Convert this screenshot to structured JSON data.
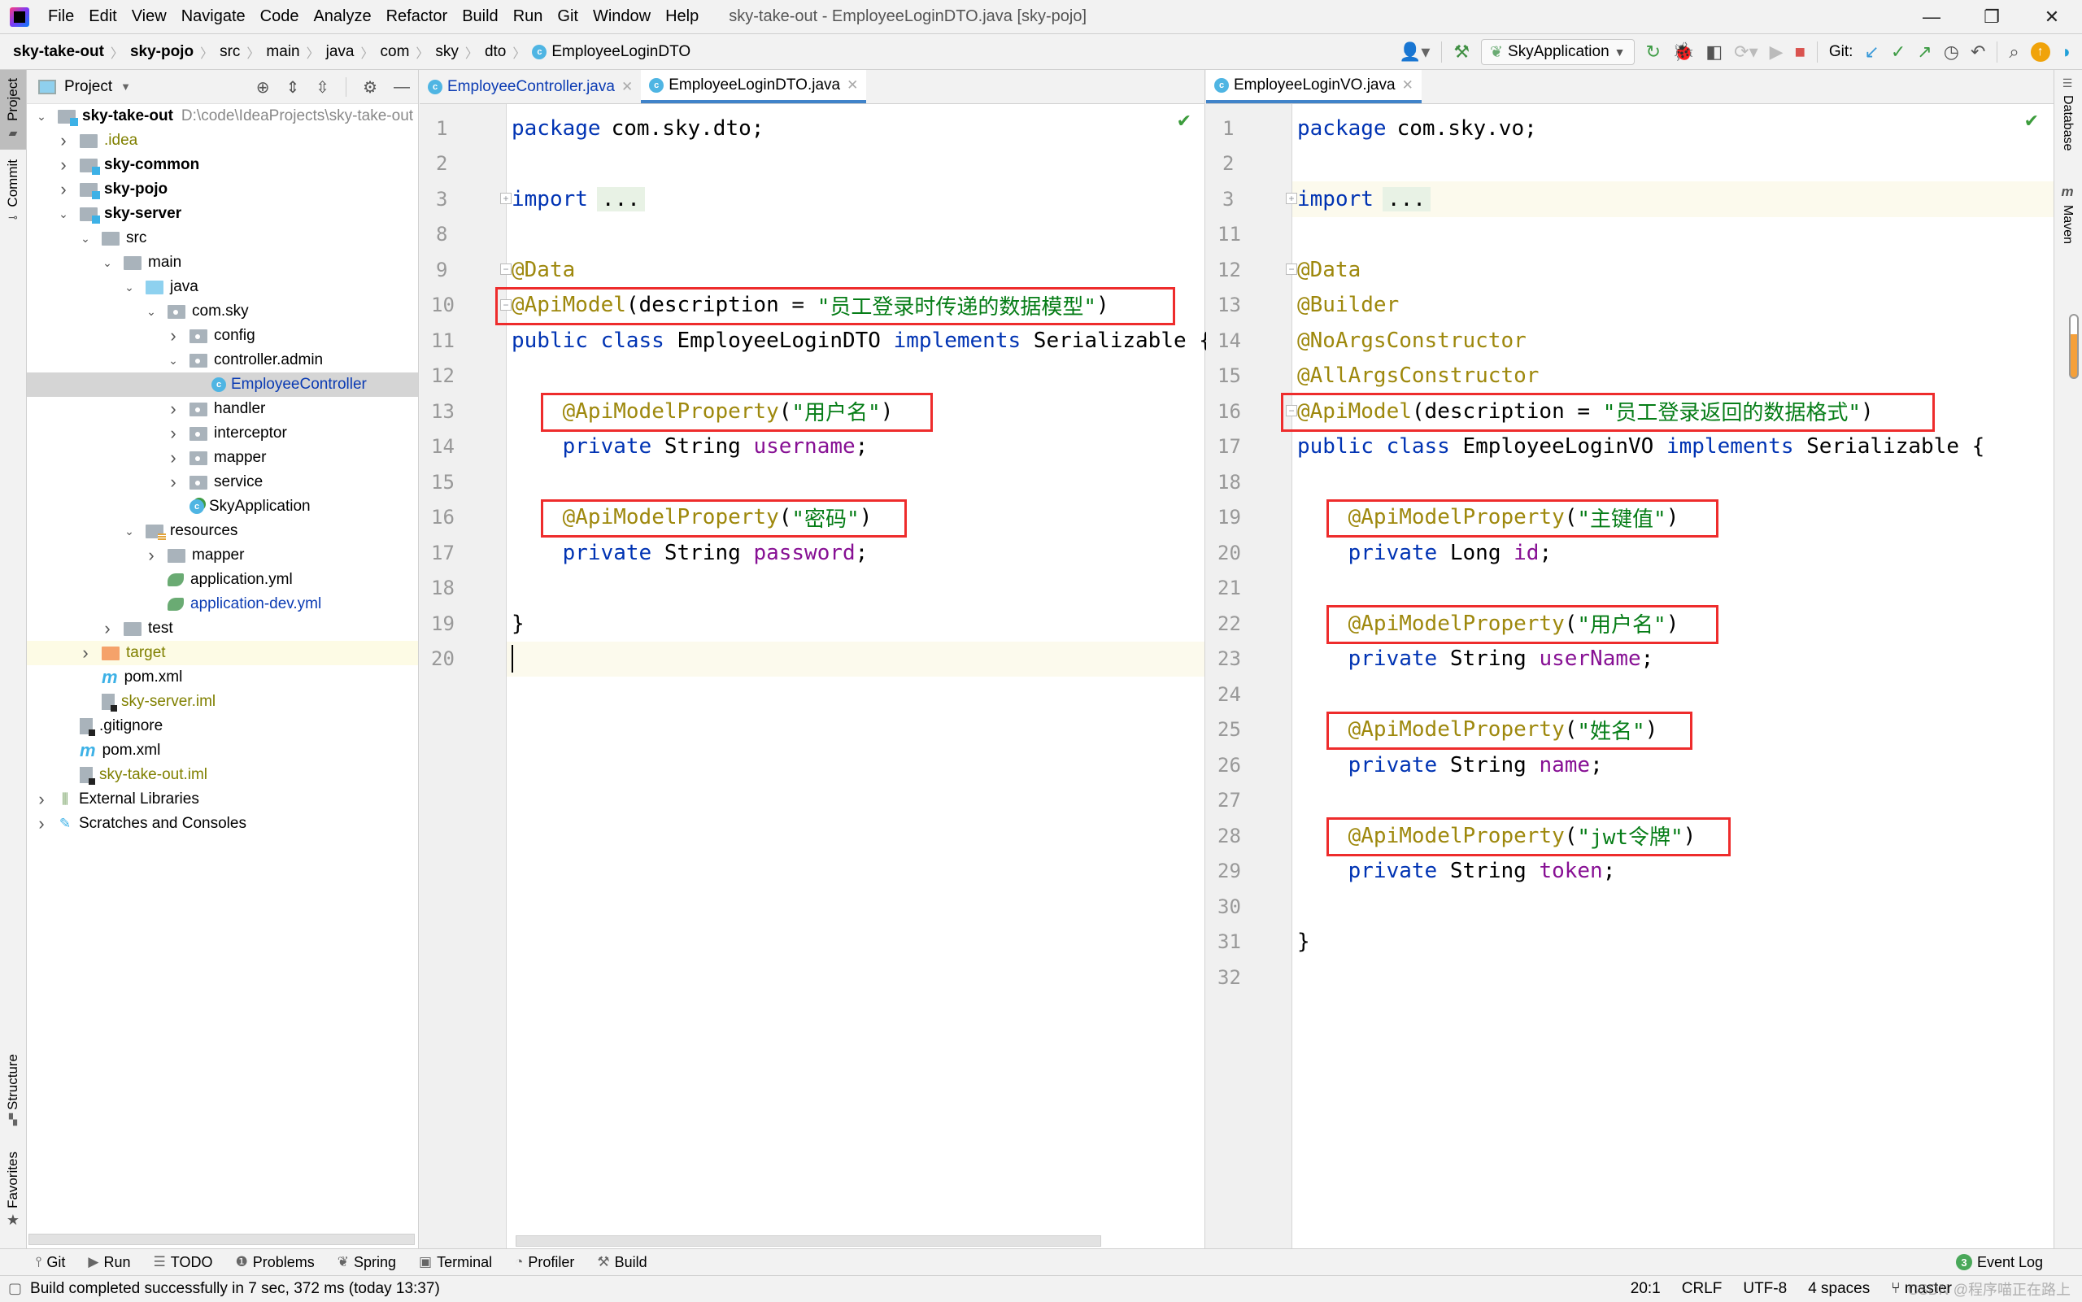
{
  "window": {
    "title": "sky-take-out - EmployeeLoginDTO.java [sky-pojo]",
    "menu": [
      "File",
      "Edit",
      "View",
      "Navigate",
      "Code",
      "Analyze",
      "Refactor",
      "Build",
      "Run",
      "Git",
      "Window",
      "Help"
    ],
    "controls": {
      "minimize": "—",
      "restore": "❐",
      "close": "✕"
    }
  },
  "breadcrumb": [
    "sky-take-out",
    "sky-pojo",
    "src",
    "main",
    "java",
    "com",
    "sky",
    "dto",
    "EmployeeLoginDTO"
  ],
  "toolbar": {
    "run_config": "SkyApplication",
    "git_label": "Git:"
  },
  "left_strip": {
    "project": "Project",
    "commit": "Commit",
    "structure": "Structure",
    "favorites": "Favorites"
  },
  "right_strip": {
    "database": "Database",
    "maven": "Maven"
  },
  "project_panel": {
    "title": "Project",
    "tree": [
      {
        "label": "sky-take-out",
        "path": "D:\\code\\IdeaProjects\\sky-take-out",
        "depth": 0,
        "chevron": "down",
        "icon": "module-folder",
        "style": "bold"
      },
      {
        "label": ".idea",
        "depth": 1,
        "chevron": "right",
        "icon": "folder",
        "style": "olive"
      },
      {
        "label": "sky-common",
        "depth": 1,
        "chevron": "right",
        "icon": "module-folder",
        "style": "bold"
      },
      {
        "label": "sky-pojo",
        "depth": 1,
        "chevron": "right",
        "icon": "module-folder",
        "style": "bold"
      },
      {
        "label": "sky-server",
        "depth": 1,
        "chevron": "down",
        "icon": "module-folder",
        "style": "bold"
      },
      {
        "label": "src",
        "depth": 2,
        "chevron": "down",
        "icon": "folder",
        "style": ""
      },
      {
        "label": "main",
        "depth": 3,
        "chevron": "down",
        "icon": "folder",
        "style": ""
      },
      {
        "label": "java",
        "depth": 4,
        "chevron": "down",
        "icon": "source-folder",
        "style": ""
      },
      {
        "label": "com.sky",
        "depth": 5,
        "chevron": "down",
        "icon": "package",
        "style": ""
      },
      {
        "label": "config",
        "depth": 6,
        "chevron": "right",
        "icon": "package",
        "style": ""
      },
      {
        "label": "controller.admin",
        "depth": 6,
        "chevron": "down",
        "icon": "package",
        "style": ""
      },
      {
        "label": "EmployeeController",
        "depth": 7,
        "chevron": "",
        "icon": "class",
        "style": "blue",
        "selected": true
      },
      {
        "label": "handler",
        "depth": 6,
        "chevron": "right",
        "icon": "package",
        "style": ""
      },
      {
        "label": "interceptor",
        "depth": 6,
        "chevron": "right",
        "icon": "package",
        "style": ""
      },
      {
        "label": "mapper",
        "depth": 6,
        "chevron": "right",
        "icon": "package",
        "style": ""
      },
      {
        "label": "service",
        "depth": 6,
        "chevron": "right",
        "icon": "package",
        "style": ""
      },
      {
        "label": "SkyApplication",
        "depth": 6,
        "chevron": "",
        "icon": "spring-boot-class",
        "style": ""
      },
      {
        "label": "resources",
        "depth": 4,
        "chevron": "down",
        "icon": "resources-folder",
        "style": ""
      },
      {
        "label": "mapper",
        "depth": 5,
        "chevron": "right",
        "icon": "folder",
        "style": ""
      },
      {
        "label": "application.yml",
        "depth": 5,
        "chevron": "",
        "icon": "spring-config",
        "style": ""
      },
      {
        "label": "application-dev.yml",
        "depth": 5,
        "chevron": "",
        "icon": "spring-config",
        "style": "blue"
      },
      {
        "label": "test",
        "depth": 3,
        "chevron": "right",
        "icon": "folder",
        "style": ""
      },
      {
        "label": "target",
        "depth": 2,
        "chevron": "right",
        "icon": "excluded-folder",
        "style": "olive",
        "excluded": true
      },
      {
        "label": "pom.xml",
        "depth": 2,
        "chevron": "",
        "icon": "maven",
        "style": ""
      },
      {
        "label": "sky-server.iml",
        "depth": 2,
        "chevron": "",
        "icon": "iml",
        "style": "olive"
      },
      {
        "label": ".gitignore",
        "depth": 1,
        "chevron": "",
        "icon": "ignore-file",
        "style": ""
      },
      {
        "label": "pom.xml",
        "depth": 1,
        "chevron": "",
        "icon": "maven",
        "style": ""
      },
      {
        "label": "sky-take-out.iml",
        "depth": 1,
        "chevron": "",
        "icon": "iml",
        "style": "olive"
      },
      {
        "label": "External Libraries",
        "depth": 0,
        "chevron": "right",
        "icon": "libraries",
        "style": ""
      },
      {
        "label": "Scratches and Consoles",
        "depth": 0,
        "chevron": "right",
        "icon": "scratches",
        "style": ""
      }
    ]
  },
  "left_editor": {
    "tabs": [
      {
        "label": "EmployeeController.java",
        "active": false
      },
      {
        "label": "EmployeeLoginDTO.java",
        "active": true
      }
    ],
    "lines": [
      {
        "n": "1",
        "tokens": [
          [
            "kw",
            "package"
          ],
          [
            "",
            "com.sky.dto;"
          ]
        ]
      },
      {
        "n": "2",
        "tokens": []
      },
      {
        "n": "3",
        "tokens": [
          [
            "kw",
            "import"
          ],
          [
            "",
            ""
          ],
          [
            "ellipsis",
            "..."
          ]
        ],
        "fold": "+"
      },
      {
        "n": "8",
        "tokens": []
      },
      {
        "n": "9",
        "tokens": [
          [
            "ann",
            "@Data"
          ]
        ],
        "fold": "-"
      },
      {
        "n": "10",
        "tokens": [
          [
            "ann",
            "@ApiModel"
          ],
          [
            "",
            "(description = "
          ],
          [
            "str",
            "\"员工登录时传递的数据模型\""
          ],
          [
            "",
            ")"
          ]
        ],
        "fold": "-",
        "boxed": true
      },
      {
        "n": "11",
        "tokens": [
          [
            "kw",
            "public class "
          ],
          [
            "",
            "EmployeeLoginDTO "
          ],
          [
            "kw",
            "implements "
          ],
          [
            "",
            "Serializable {"
          ]
        ]
      },
      {
        "n": "12",
        "tokens": []
      },
      {
        "n": "13",
        "tokens": [
          [
            "",
            "    "
          ],
          [
            "ann",
            "@ApiModelProperty"
          ],
          [
            "",
            "("
          ],
          [
            "str",
            "\"用户名\""
          ],
          [
            "",
            ")"
          ]
        ],
        "boxed": true
      },
      {
        "n": "14",
        "tokens": [
          [
            "",
            "    "
          ],
          [
            "kw",
            "private "
          ],
          [
            "",
            "String "
          ],
          [
            "fld",
            "username"
          ],
          [
            "",
            ";"
          ]
        ]
      },
      {
        "n": "15",
        "tokens": []
      },
      {
        "n": "16",
        "tokens": [
          [
            "",
            "    "
          ],
          [
            "ann",
            "@ApiModelProperty"
          ],
          [
            "",
            "("
          ],
          [
            "str",
            "\"密码\""
          ],
          [
            "",
            ")"
          ]
        ],
        "boxed": true
      },
      {
        "n": "17",
        "tokens": [
          [
            "",
            "    "
          ],
          [
            "kw",
            "private "
          ],
          [
            "",
            "String "
          ],
          [
            "fld",
            "password"
          ],
          [
            "",
            ";"
          ]
        ]
      },
      {
        "n": "18",
        "tokens": []
      },
      {
        "n": "19",
        "tokens": [
          [
            "",
            "}"
          ]
        ]
      },
      {
        "n": "20",
        "tokens": [],
        "current": true,
        "caret": true
      }
    ]
  },
  "right_editor": {
    "tabs": [
      {
        "label": "EmployeeLoginVO.java",
        "active": true
      }
    ],
    "lines": [
      {
        "n": "1",
        "tokens": [
          [
            "kw",
            "package"
          ],
          [
            "",
            "com.sky.vo;"
          ]
        ]
      },
      {
        "n": "2",
        "tokens": []
      },
      {
        "n": "3",
        "tokens": [
          [
            "kw",
            "import"
          ],
          [
            "",
            ""
          ],
          [
            "ellipsis",
            "..."
          ]
        ],
        "fold": "+",
        "current": true
      },
      {
        "n": "11",
        "tokens": []
      },
      {
        "n": "12",
        "tokens": [
          [
            "ann",
            "@Data"
          ]
        ],
        "fold": "-"
      },
      {
        "n": "13",
        "tokens": [
          [
            "ann",
            "@Builder"
          ]
        ]
      },
      {
        "n": "14",
        "tokens": [
          [
            "ann",
            "@NoArgsConstructor"
          ]
        ]
      },
      {
        "n": "15",
        "tokens": [
          [
            "ann",
            "@AllArgsConstructor"
          ]
        ]
      },
      {
        "n": "16",
        "tokens": [
          [
            "ann",
            "@ApiModel"
          ],
          [
            "",
            "(description = "
          ],
          [
            "str",
            "\"员工登录返回的数据格式\""
          ],
          [
            "",
            ")"
          ]
        ],
        "fold": "-",
        "boxed": true
      },
      {
        "n": "17",
        "tokens": [
          [
            "kw",
            "public class "
          ],
          [
            "",
            "EmployeeLoginVO "
          ],
          [
            "kw",
            "implements "
          ],
          [
            "",
            "Serializable {"
          ]
        ]
      },
      {
        "n": "18",
        "tokens": []
      },
      {
        "n": "19",
        "tokens": [
          [
            "",
            "    "
          ],
          [
            "ann",
            "@ApiModelProperty"
          ],
          [
            "",
            "("
          ],
          [
            "str",
            "\"主键值\""
          ],
          [
            "",
            ")"
          ]
        ],
        "boxed": true
      },
      {
        "n": "20",
        "tokens": [
          [
            "",
            "    "
          ],
          [
            "kw",
            "private "
          ],
          [
            "",
            "Long "
          ],
          [
            "fld",
            "id"
          ],
          [
            "",
            ";"
          ]
        ]
      },
      {
        "n": "21",
        "tokens": []
      },
      {
        "n": "22",
        "tokens": [
          [
            "",
            "    "
          ],
          [
            "ann",
            "@ApiModelProperty"
          ],
          [
            "",
            "("
          ],
          [
            "str",
            "\"用户名\""
          ],
          [
            "",
            ")"
          ]
        ],
        "boxed": true
      },
      {
        "n": "23",
        "tokens": [
          [
            "",
            "    "
          ],
          [
            "kw",
            "private "
          ],
          [
            "",
            "String "
          ],
          [
            "fld",
            "userName"
          ],
          [
            "",
            ";"
          ]
        ]
      },
      {
        "n": "24",
        "tokens": []
      },
      {
        "n": "25",
        "tokens": [
          [
            "",
            "    "
          ],
          [
            "ann",
            "@ApiModelProperty"
          ],
          [
            "",
            "("
          ],
          [
            "str",
            "\"姓名\""
          ],
          [
            "",
            ")"
          ]
        ],
        "boxed": true
      },
      {
        "n": "26",
        "tokens": [
          [
            "",
            "    "
          ],
          [
            "kw",
            "private "
          ],
          [
            "",
            "String "
          ],
          [
            "fld",
            "name"
          ],
          [
            "",
            ";"
          ]
        ]
      },
      {
        "n": "27",
        "tokens": []
      },
      {
        "n": "28",
        "tokens": [
          [
            "",
            "    "
          ],
          [
            "ann",
            "@ApiModelProperty"
          ],
          [
            "",
            "("
          ],
          [
            "str",
            "\"jwt令牌\""
          ],
          [
            "",
            ")"
          ]
        ],
        "boxed": true
      },
      {
        "n": "29",
        "tokens": [
          [
            "",
            "    "
          ],
          [
            "kw",
            "private "
          ],
          [
            "",
            "String "
          ],
          [
            "fld",
            "token"
          ],
          [
            "",
            ";"
          ]
        ]
      },
      {
        "n": "30",
        "tokens": []
      },
      {
        "n": "31",
        "tokens": [
          [
            "",
            "}"
          ]
        ]
      },
      {
        "n": "32",
        "tokens": []
      }
    ]
  },
  "tool_windows": [
    "Git",
    "Run",
    "TODO",
    "Problems",
    "Spring",
    "Terminal",
    "Profiler",
    "Build"
  ],
  "event_log": {
    "label": "Event Log",
    "count": "3"
  },
  "status": {
    "message": "Build completed successfully in 7 sec, 372 ms (today 13:37)",
    "position": "20:1",
    "line_separator": "CRLF",
    "encoding": "UTF-8",
    "indent": "4 spaces",
    "branch": "master"
  },
  "watermark": "CSDN @程序喵正在路上",
  "colors": {
    "highlight_box": "#ee2c2c",
    "keyword": "#0033b3",
    "annotation": "#9e880d",
    "string": "#067d17",
    "field": "#871094",
    "accent": "#4083c9"
  }
}
